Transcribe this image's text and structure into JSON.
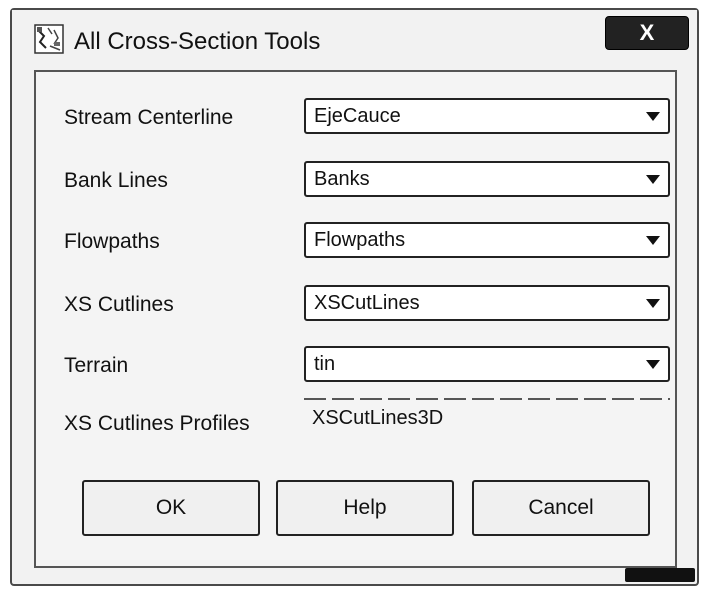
{
  "window": {
    "title": "All Cross-Section Tools",
    "close_label": "X"
  },
  "fields": [
    {
      "label": "Stream Centerline",
      "value": "EjeCauce"
    },
    {
      "label": "Bank Lines",
      "value": "Banks"
    },
    {
      "label": "Flowpaths",
      "value": "Flowpaths"
    },
    {
      "label": "XS Cutlines",
      "value": "XSCutLines"
    },
    {
      "label": "Terrain",
      "value": "tin"
    }
  ],
  "profiles": {
    "label": "XS Cutlines Profiles",
    "value": "XSCutLines3D"
  },
  "buttons": {
    "ok": "OK",
    "help": "Help",
    "cancel": "Cancel"
  },
  "icons": {
    "app": "cross-section-tool-icon",
    "close": "close-icon",
    "dropdown": "chevron-down-icon"
  }
}
